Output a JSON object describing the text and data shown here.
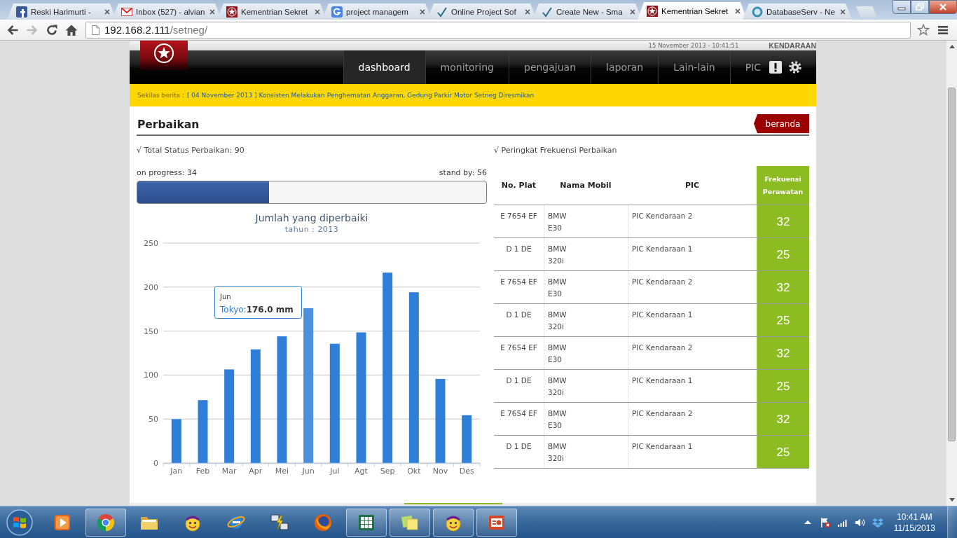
{
  "browser": {
    "tabs": [
      {
        "kind": "social",
        "title": "Reski Harimurti -",
        "selected": false
      },
      {
        "kind": "mail",
        "title": "Inbox (527) - alvian",
        "selected": false
      },
      {
        "kind": "emblem",
        "title": "Kementrian Sekret",
        "selected": false
      },
      {
        "kind": "search",
        "title": "project managem",
        "selected": false
      },
      {
        "kind": "tick",
        "title": "Online Project Sof",
        "selected": false
      },
      {
        "kind": "tick",
        "title": "Create New - Sma",
        "selected": false
      },
      {
        "kind": "emblem",
        "title": "Kementrian Sekret",
        "selected": true
      },
      {
        "kind": "ring",
        "title": "DatabaseServ - Ne",
        "selected": false
      }
    ],
    "nav_buttons": [
      {
        "kind": "back",
        "disabled": false
      },
      {
        "kind": "forward",
        "disabled": true
      },
      {
        "kind": "reload",
        "disabled": false
      },
      {
        "kind": "home",
        "disabled": false
      }
    ],
    "address": {
      "host": "192.168.2.111",
      "path": "/setneg/"
    }
  },
  "header": {
    "datetime": "15 November 2013 - 10:41:51",
    "section": "KENDARAAN",
    "menu": [
      {
        "label": "dashboard",
        "selected": true
      },
      {
        "label": "monitoring",
        "selected": false
      },
      {
        "label": "pengajuan",
        "selected": false
      },
      {
        "label": "laporan",
        "selected": false
      },
      {
        "label": "Lain-lain",
        "selected": false
      },
      {
        "label": "PIC",
        "selected": false
      }
    ]
  },
  "ticker": {
    "label": "Sekilas berita :",
    "news": "[ 04 November 2013 ] Konsisten Melakukan Penghematan Anggaran, Gedung Parkir Motor Setneg Diresmikan"
  },
  "page": {
    "title": "Perbaikan",
    "home_button": "beranda"
  },
  "status": {
    "heading": "√ Total Status Perbaikan: 90",
    "on_progress": "on progress: 34",
    "stand_by": "stand by: 56",
    "level": 0.378
  },
  "chart": {
    "subtitle": "tahun : 2013",
    "chart_data": {
      "type": "bar",
      "title": "Jumlah yang diperbaiki",
      "categories": [
        "Jan",
        "Feb",
        "Mar",
        "Apr",
        "Mei",
        "Jun",
        "Jul",
        "Agt",
        "Sep",
        "Okt",
        "Nov",
        "Des"
      ],
      "series": [
        {
          "name": "Tokyo",
          "color": "#2f7ed8",
          "values": [
            49.9,
            71.5,
            106.4,
            129.2,
            144.0,
            176.0,
            135.6,
            148.5,
            216.4,
            194.1,
            95.6,
            54.4
          ]
        }
      ],
      "ylim": [
        0,
        250
      ],
      "yticks": [
        0,
        50,
        100,
        150,
        200,
        250
      ],
      "grid": true
    },
    "bars": [
      {
        "hovered": false
      },
      {
        "hovered": false
      },
      {
        "hovered": false
      },
      {
        "hovered": false
      },
      {
        "hovered": false
      },
      {
        "hovered": true
      },
      {
        "hovered": false
      },
      {
        "hovered": false
      },
      {
        "hovered": false
      },
      {
        "hovered": false
      },
      {
        "hovered": false
      },
      {
        "hovered": false
      }
    ],
    "tooltip": {
      "category": "Jun",
      "separator": ":",
      "value": "176.0 mm"
    }
  },
  "ranking": {
    "heading": "√ Peringkat Frekuensi Perbaikan",
    "columns": [
      "No. Plat",
      "Nama Mobil",
      "PIC",
      "Frekuensi Perawatan"
    ],
    "rows": [
      {
        "plate": "E 7654 EF",
        "make": "BMW",
        "model": "E30",
        "pic": "PIC Kendaraan 2",
        "frequency": "32"
      },
      {
        "plate": "D 1 DE",
        "make": "BMW",
        "model": "320i",
        "pic": "PIC Kendaraan 1",
        "frequency": "25"
      },
      {
        "plate": "E 7654 EF",
        "make": "BMW",
        "model": "E30",
        "pic": "PIC Kendaraan 2",
        "frequency": "32"
      },
      {
        "plate": "D 1 DE",
        "make": "BMW",
        "model": "320i",
        "pic": "PIC Kendaraan 1",
        "frequency": "25"
      },
      {
        "plate": "E 7654 EF",
        "make": "BMW",
        "model": "E30",
        "pic": "PIC Kendaraan 2",
        "frequency": "32"
      },
      {
        "plate": "D 1 DE",
        "make": "BMW",
        "model": "320i",
        "pic": "PIC Kendaraan 1",
        "frequency": "25"
      },
      {
        "plate": "E 7654 EF",
        "make": "BMW",
        "model": "E30",
        "pic": "PIC Kendaraan 2",
        "frequency": "32"
      },
      {
        "plate": "D 1 DE",
        "make": "BMW",
        "model": "320i",
        "pic": "PIC Kendaraan 1",
        "frequency": "25"
      }
    ]
  },
  "taskbar": {
    "items": [
      {
        "kind": "player",
        "open": false
      },
      {
        "kind": "browser-circle",
        "open": true
      },
      {
        "kind": "folder",
        "open": false
      },
      {
        "kind": "messenger",
        "open": false
      },
      {
        "kind": "browser-ring",
        "open": false
      },
      {
        "kind": "terminal",
        "open": false
      },
      {
        "kind": "browser-globe",
        "open": false
      },
      {
        "kind": "spreadsheet",
        "open": true
      },
      {
        "kind": "notes",
        "open": true
      },
      {
        "kind": "messenger",
        "open": true
      },
      {
        "kind": "slides",
        "open": true
      }
    ],
    "clock": {
      "time": "10:41 AM",
      "date": "11/15/2013"
    }
  }
}
